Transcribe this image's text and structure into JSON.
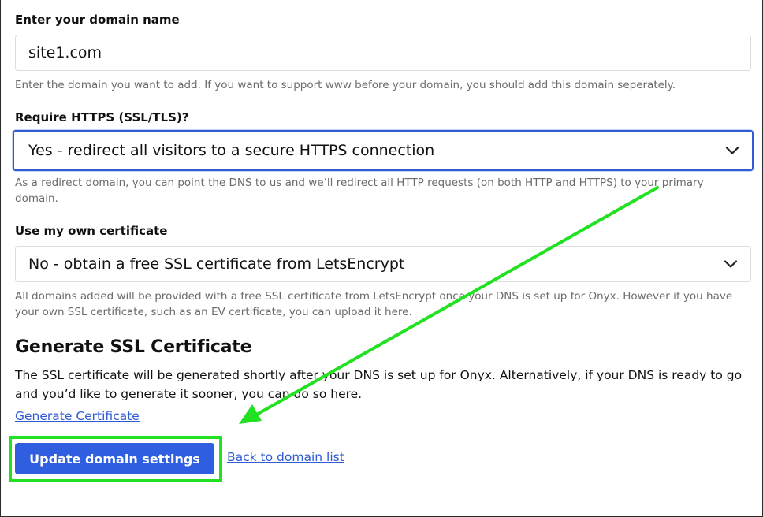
{
  "domain_section": {
    "label": "Enter your domain name",
    "input_value": "site1.com",
    "help": "Enter the domain you want to add. If you want to support www before your domain, you should add this domain seperately."
  },
  "https_section": {
    "label": "Require HTTPS (SSL/TLS)?",
    "selected": "Yes - redirect all visitors to a secure HTTPS connection",
    "help": "As a redirect domain, you can point the DNS to us and we’ll redirect all HTTP requests (on both HTTP and HTTPS) to your primary domain."
  },
  "certificate_section": {
    "label": "Use my own certificate",
    "selected": "No - obtain a free SSL certificate from LetsEncrypt",
    "help": "All domains added will be provided with a free SSL certificate from LetsEncrypt once your DNS is set up for Onyx. However if you have your own SSL certificate, such as an EV certificate, you can upload it here."
  },
  "generate_section": {
    "heading": "Generate SSL Certificate",
    "body": "The SSL certificate will be generated shortly after your DNS is set up for Onyx. Alternatively, if your DNS is ready to go and you’d like to generate it sooner, you can do so here.",
    "link": "Generate Certificate"
  },
  "actions": {
    "primary_button": "Update domain settings",
    "back_link": "Back to domain list"
  },
  "colors": {
    "accent": "#2f5fe0",
    "annotation": "#22e022"
  },
  "icons": {
    "select_chevron": "chevron-down-icon",
    "annotation_arrow": "arrow-icon"
  }
}
